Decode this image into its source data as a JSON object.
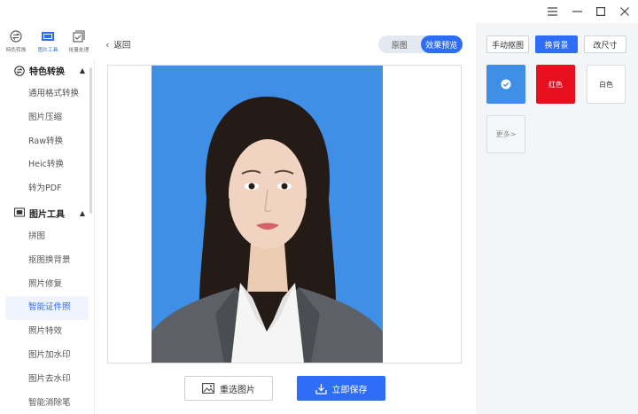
{
  "window": {
    "controls": [
      "menu-icon",
      "minimize-icon",
      "maximize-icon",
      "close-icon"
    ]
  },
  "topnav": {
    "items": [
      {
        "label": "特色转换",
        "icon": "convert-icon",
        "active": false
      },
      {
        "label": "图片工具",
        "icon": "image-tools-icon",
        "active": true
      },
      {
        "label": "批量处理",
        "icon": "batch-icon",
        "active": false
      }
    ]
  },
  "sidebar": {
    "group1": {
      "label": "特色转换"
    },
    "group1_items": [
      "通用格式转换",
      "图片压缩",
      "Raw转换",
      "Heic转换",
      "转为PDF"
    ],
    "group2": {
      "label": "图片工具"
    },
    "group2_items": [
      "拼图",
      "抠图换背景",
      "照片修复",
      "智能证件照",
      "照片特效",
      "图片加水印",
      "图片去水印",
      "智能消除笔"
    ],
    "active_item": "智能证件照"
  },
  "main": {
    "back_label": "返回",
    "toggle": {
      "original": "原图",
      "preview": "效果预览"
    },
    "reselect_label": "重选图片",
    "save_label": "立即保存"
  },
  "right_panel": {
    "tabs": {
      "manual": "手动抠图",
      "background": "换背景",
      "resize": "改尺寸"
    },
    "swatches": [
      {
        "label": "",
        "color": "#3f8fe6",
        "selected": true
      },
      {
        "label": "红色",
        "color": "#e8101f",
        "selected": false
      },
      {
        "label": "白色",
        "color": "#ffffff",
        "selected": false
      }
    ],
    "more_label": "更多>"
  },
  "colors": {
    "accent": "#2e6ef7",
    "photo_bg": "#3f8fe6",
    "red": "#e8101f"
  }
}
